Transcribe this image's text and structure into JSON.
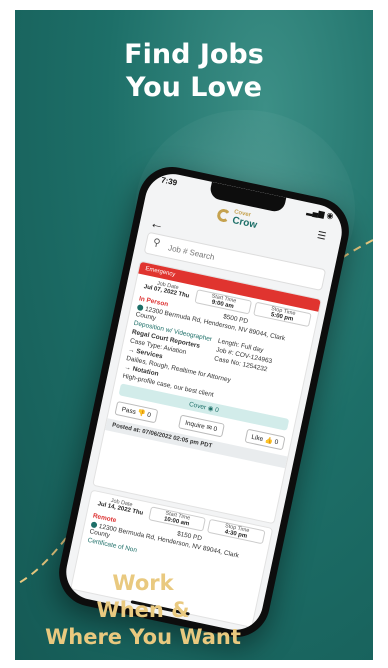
{
  "headline": [
    "Find Jobs",
    "You Love"
  ],
  "tagline": [
    "Work",
    "When &",
    "Where You Want"
  ],
  "colors": {
    "teal": "#1d6f68",
    "gold": "#e9c97f",
    "emergency": "#e0342f"
  },
  "phone": {
    "time": "7:39",
    "logo_small": "Cover",
    "logo_large": "Crow",
    "search_placeholder": "Job # Search",
    "job1": {
      "badge": "Emergency",
      "job_date_label": "Job Date",
      "job_date": "Jul 07, 2022 Thu",
      "start_label": "Start Time",
      "start": "9:00 am",
      "stop_label": "Stop Time",
      "stop": "5:00 pm",
      "mode": "In Person",
      "rate": "$500 PD",
      "address": "12300 Bermuda Rd, Henderson, NV 89044, Clark County",
      "type": "Deposition w/ Videographer",
      "length": "Length: Full day",
      "client": "Regal Court Reporters",
      "job_no": "Job #: COV-124963",
      "case_type": "Case Type: Aviation",
      "case_no": "Case No: 1254232",
      "services_label": "Services",
      "services": "Dailies, Rough, Realtime for Attorney",
      "notation_label": "Notation",
      "notation": "High-profile case, our best client",
      "cover_label": "Cover",
      "cover_count": "0",
      "like_label": "Like",
      "like_count": "0",
      "pass_label": "Pass",
      "pass_count": "0",
      "inquire_label": "Inquire",
      "inquire_count": "0",
      "posted": "Posted at: 07/06/2022 02:05 pm PDT"
    },
    "job2": {
      "job_date_label": "Job Date",
      "job_date": "Jul 14, 2022 Thu",
      "start_label": "Start Time",
      "start": "10:00 am",
      "stop_label": "Stop Time",
      "stop": "4:30 pm",
      "mode": "Remote",
      "rate": "$150 PD",
      "address": "12300 Bermuda Rd, Henderson, NV 89044, Clark County",
      "extra": "Certificate of Non"
    }
  }
}
